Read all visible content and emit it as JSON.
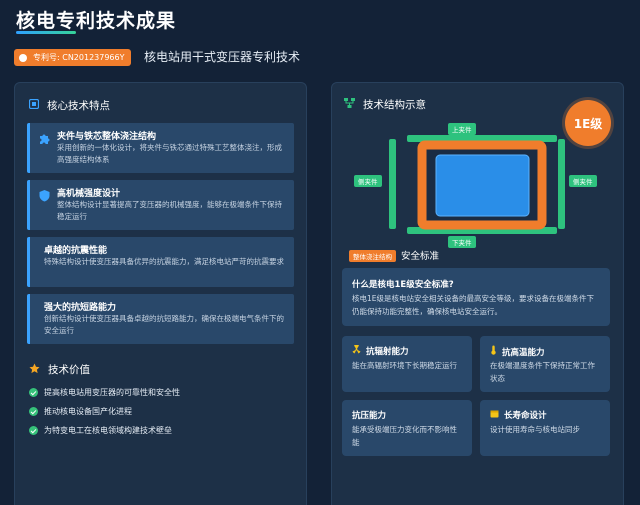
{
  "header": {
    "title": "核电专利技术成果",
    "patent_no": "专利号: CN201237966Y",
    "subtitle": "核电站用干式变压器专利技术"
  },
  "left_panel": {
    "features_title": "核心技术特点",
    "features": [
      {
        "title": "夹件与铁芯整体浇注结构",
        "desc": "采用创新的一体化设计，将夹件与铁芯通过特殊工艺整体浇注，形成高强度结构体系",
        "icon": "puzzle-icon"
      },
      {
        "title": "高机械强度设计",
        "desc": "整体结构设计显著提高了变压器的机械强度，能够在极端条件下保持稳定运行",
        "icon": "shield-icon"
      },
      {
        "title": "卓越的抗震性能",
        "desc": "特殊结构设计使变压器具备优异的抗震能力，满足核电站严苛的抗震要求",
        "icon": ""
      },
      {
        "title": "强大的抗短路能力",
        "desc": "创新结构设计使变压器具备卓越的抗短路能力，确保在极端电气条件下的安全运行",
        "icon": ""
      }
    ],
    "value_title": "技术价值",
    "values": [
      "提高核电站用变压器的可靠性和安全性",
      "推动核电设备国产化进程",
      "为特变电工在核电领域构建技术壁垒"
    ]
  },
  "right_panel": {
    "diagram_title": "技术结构示意",
    "grade": "1E级",
    "labels": {
      "top": "上夹件",
      "bottom": "下夹件",
      "left": "侧夹件",
      "right": "侧夹件",
      "cast": "整体浇注结构"
    },
    "safety_title_fragment": "安全标准",
    "qa": {
      "question": "什么是核电1E级安全标准?",
      "answer": "核电1E级是核电站安全相关设备的最高安全等级，要求设备在极端条件下仍能保持功能完整性，确保核电站安全运行。"
    },
    "cards": [
      {
        "title": "抗辐射能力",
        "desc": "能在高辐射环境下长期稳定运行",
        "icon": "radiation-icon"
      },
      {
        "title": "抗高温能力",
        "desc": "在极端温度条件下保持正常工作状态",
        "icon": "thermometer-icon"
      },
      {
        "title": "抗压能力",
        "desc": "能承受极端压力变化而不影响性能",
        "icon": ""
      },
      {
        "title": "长寿命设计",
        "desc": "设计使用寿命与核电站同步",
        "icon": "calendar-icon"
      }
    ],
    "colors": {
      "frame": "#f07d2c",
      "clamp": "#2ec27e",
      "core": "#2a8ee8"
    }
  }
}
